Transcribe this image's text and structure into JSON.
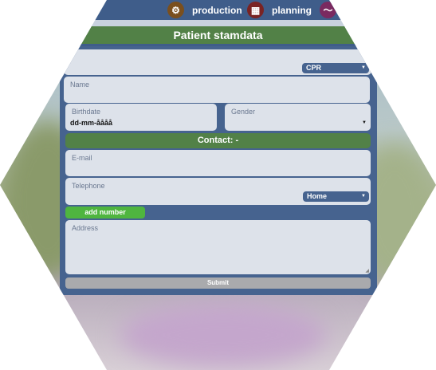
{
  "nav": {
    "items": [
      {
        "label": "production",
        "icon": "gears-icon",
        "color": "#7a4f1e"
      },
      {
        "label": "planning",
        "icon": "calendar-icon",
        "color": "#7a2323"
      },
      {
        "label": "",
        "icon": "chart-line-icon",
        "color": "#7a2a60"
      }
    ]
  },
  "title": "Patient stamdata",
  "form": {
    "id_type": "CPR",
    "name_label": "Name",
    "birthdate_label": "Birthdate",
    "birthdate_value": "dd-mm-åååå",
    "gender_label": "Gender",
    "contact_header": "Contact: -",
    "email_label": "E-mail",
    "telephone_label": "Telephone",
    "phone_type": "Home",
    "add_number": "add number",
    "address_label": "Address",
    "submit": "Submit"
  }
}
